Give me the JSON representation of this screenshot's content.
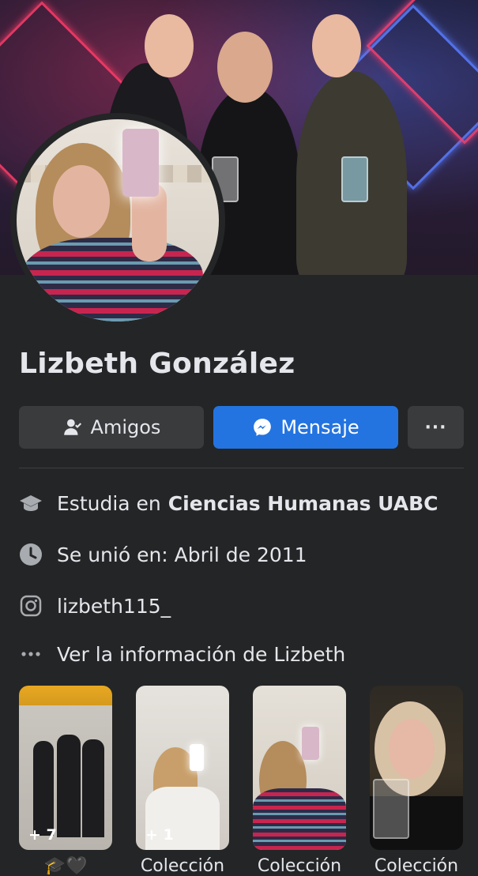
{
  "profile": {
    "name": "Lizbeth González"
  },
  "actions": {
    "friends_label": "Amigos",
    "message_label": "Mensaje",
    "more_label": "···"
  },
  "details": {
    "education_prefix": "Estudia en",
    "education_place": "Ciencias Humanas UABC",
    "joined": "Se unió en: Abril de 2011",
    "instagram": "lizbeth115_",
    "see_info": "Ver la información de Lizbeth"
  },
  "featured": [
    {
      "count": "+ 7",
      "label": "🎓🖤"
    },
    {
      "count": "+ 1",
      "label": "Colección"
    },
    {
      "count": "",
      "label": "Colección"
    },
    {
      "count": "",
      "label": "Colección"
    }
  ],
  "colors": {
    "background": "#242526",
    "primary_button": "#2374e1",
    "secondary_button": "#3a3b3c",
    "text": "#e4e6eb"
  },
  "icons": {
    "friends": "person-check-icon",
    "message": "messenger-icon",
    "more": "more-dots-icon",
    "education": "graduation-cap-icon",
    "joined": "clock-icon",
    "instagram": "instagram-icon",
    "see_info": "more-dots-icon"
  }
}
